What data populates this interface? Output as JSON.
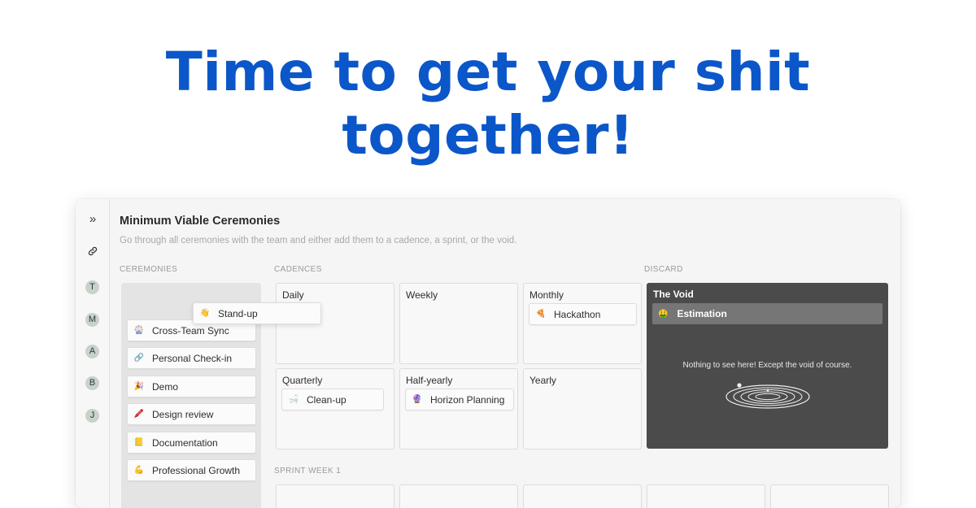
{
  "hero": {
    "line1": "Time to get your shit",
    "line2": "together!"
  },
  "rail": {
    "expand_icon": "double-chevron-right-icon",
    "link_icon": "link-icon",
    "avatars": [
      "T",
      "M",
      "A",
      "B",
      "J"
    ]
  },
  "board": {
    "title": "Minimum Viable Ceremonies",
    "subtitle": "Go through all ceremonies with the team and either add them to a cadence, a sprint, or the void.",
    "sections": {
      "ceremonies": "CEREMONIES",
      "cadences": "CADENCES",
      "discard": "DISCARD",
      "sprint": "SPRINT WEEK 1"
    }
  },
  "ceremonies": [
    {
      "emoji": "🎡",
      "label": "Cross-Team Sync"
    },
    {
      "emoji": "🔗",
      "label": "Personal Check-in"
    },
    {
      "emoji": "🎉",
      "label": "Demo"
    },
    {
      "emoji": "🖍️",
      "label": "Design review"
    },
    {
      "emoji": "📒",
      "label": "Documentation"
    },
    {
      "emoji": "💪",
      "label": "Professional Growth"
    }
  ],
  "dragging": {
    "emoji": "👋",
    "label": "Stand-up"
  },
  "cadences": {
    "daily": {
      "title": "Daily"
    },
    "weekly": {
      "title": "Weekly"
    },
    "monthly": {
      "title": "Monthly",
      "item": {
        "emoji": "🍕",
        "label": "Hackathon"
      }
    },
    "quarterly": {
      "title": "Quarterly",
      "item": {
        "emoji": "🛁",
        "label": "Clean-up"
      }
    },
    "halfyearly": {
      "title": "Half-yearly",
      "item": {
        "emoji": "🔮",
        "label": "Horizon Planning"
      }
    },
    "yearly": {
      "title": "Yearly"
    }
  },
  "void": {
    "title": "The Void",
    "item": {
      "emoji": "🤑",
      "label": "Estimation"
    },
    "text": "Nothing to see here! Except the void of course.",
    "graphic": "black-hole-icon"
  }
}
